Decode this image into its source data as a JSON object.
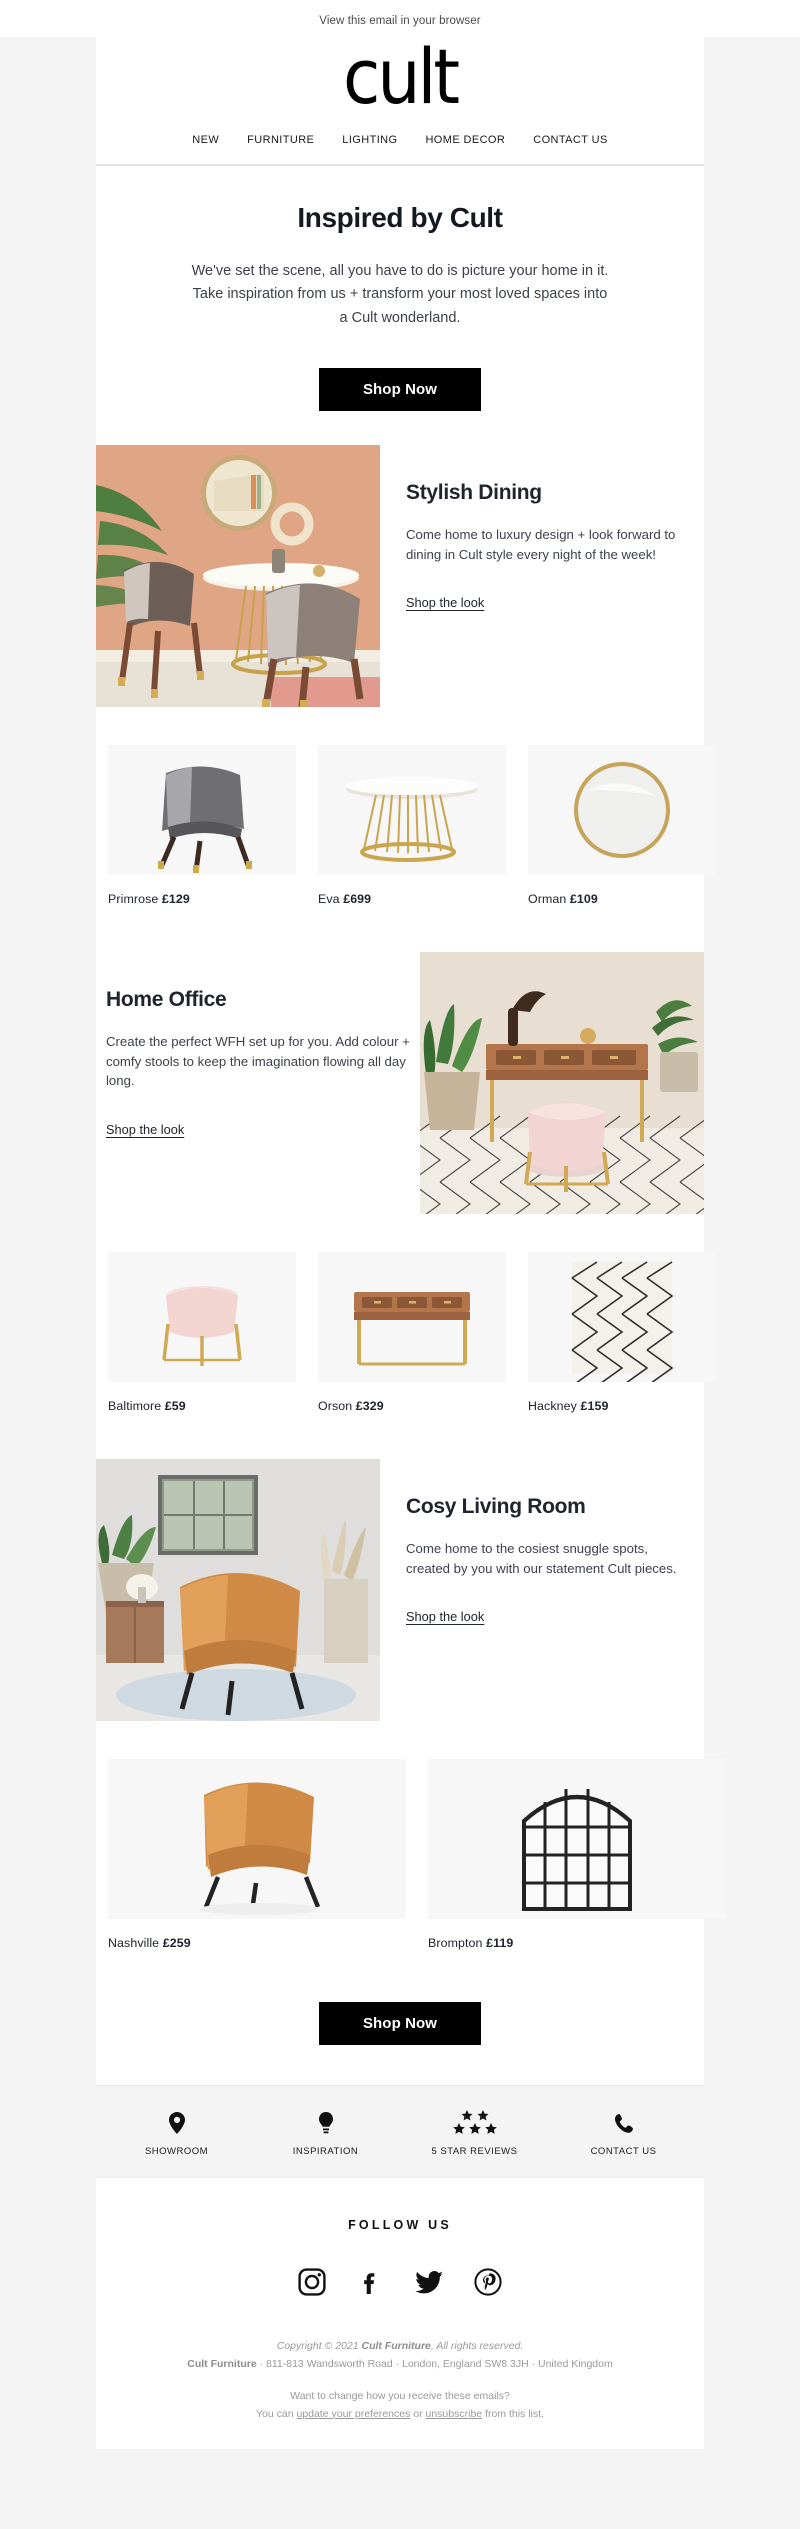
{
  "preheader": {
    "text": "View this email in your browser"
  },
  "header": {
    "logo_text": "cult",
    "nav": [
      {
        "label": "NEW"
      },
      {
        "label": "FURNITURE"
      },
      {
        "label": "LIGHTING"
      },
      {
        "label": "HOME DECOR"
      },
      {
        "label": "CONTACT US"
      }
    ]
  },
  "hero": {
    "title": "Inspired by Cult",
    "body": "We've set the scene, all you have to do is picture your home in it. Take inspiration from us + transform your most loved spaces into a Cult wonderland.",
    "cta_label": "Shop Now"
  },
  "sections": [
    {
      "title": "Stylish Dining",
      "body": "Come home to luxury design + look forward to dining in Cult style every night of the week!",
      "link_label": "Shop the look",
      "scene_alt": "dining-room-scene",
      "products": [
        {
          "name": "Primrose",
          "price": "£129",
          "alt": "grey-armchair"
        },
        {
          "name": "Eva",
          "price": "£699",
          "alt": "gold-base-dining-table"
        },
        {
          "name": "Orman",
          "price": "£109",
          "alt": "round-gold-mirror"
        }
      ]
    },
    {
      "title": "Home Office",
      "body": "Create the perfect WFH set up for you. Add colour + comfy stools to keep the imagination flowing all day long.",
      "link_label": "Shop the look",
      "scene_alt": "home-office-scene",
      "products": [
        {
          "name": "Baltimore",
          "price": "£59",
          "alt": "pink-velvet-stool"
        },
        {
          "name": "Orson",
          "price": "£329",
          "alt": "gold-console-desk"
        },
        {
          "name": "Hackney",
          "price": "£159",
          "alt": "diamond-pattern-rug"
        }
      ]
    },
    {
      "title": "Cosy Living Room",
      "body": "Come home to the cosiest snuggle spots, created by you with our statement Cult pieces.",
      "link_label": "Shop the look",
      "scene_alt": "living-room-scene",
      "products": [
        {
          "name": "Nashville",
          "price": "£259",
          "alt": "tan-tub-armchair"
        },
        {
          "name": "Brompton",
          "price": "£119",
          "alt": "arched-window-mirror"
        }
      ]
    }
  ],
  "footer_cta": {
    "label": "Shop Now"
  },
  "infobar": [
    {
      "icon": "location-pin-icon",
      "label": "SHOWROOM"
    },
    {
      "icon": "lightbulb-icon",
      "label": "INSPIRATION"
    },
    {
      "icon": "five-stars-icon",
      "label": "5 STAR REVIEWS"
    },
    {
      "icon": "phone-icon",
      "label": "CONTACT US"
    }
  ],
  "follow": {
    "title": "FOLLOW US",
    "socials": [
      {
        "icon": "instagram-icon",
        "name": "Instagram"
      },
      {
        "icon": "facebook-icon",
        "name": "Facebook"
      },
      {
        "icon": "twitter-icon",
        "name": "Twitter"
      },
      {
        "icon": "pinterest-icon",
        "name": "Pinterest"
      }
    ]
  },
  "legal": {
    "copyright_pre": "Copyright © 2021 ",
    "copyright_brand": "Cult Furniture",
    "copyright_post": ", All rights reserved.",
    "address_brand": "Cult Furniture",
    "address_rest": " · 811-813 Wandsworth Road · London, England SW8 3JH · United Kingdom",
    "prefs_question": "Want to change how you receive these emails?",
    "prefs_pre": "You can ",
    "prefs_link": "update your preferences",
    "prefs_mid": " or ",
    "unsub_link": "unsubscribe",
    "prefs_post": " from this list."
  },
  "colors": {
    "accent_black": "#000000",
    "page_bg": "#f4f4f4",
    "body_bg": "#ffffff",
    "infobar_bg": "#f4f4f4",
    "text_dark": "#20242c",
    "text_muted": "#9a9a9a"
  }
}
